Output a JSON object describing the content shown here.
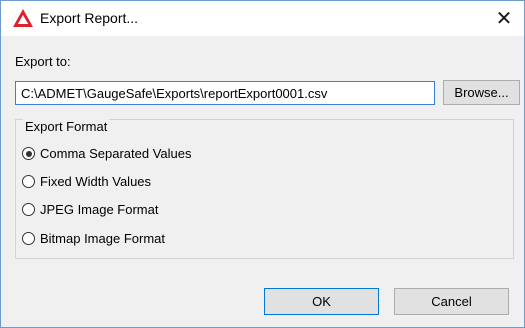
{
  "window": {
    "title": "Export Report...",
    "app_icon": "admet-warning-triangle-icon",
    "close_glyph": "✕"
  },
  "export_to": {
    "label": "Export to:",
    "path_value": "C:\\ADMET\\GaugeSafe\\Exports\\reportExport0001.csv",
    "browse_label": "Browse..."
  },
  "export_format": {
    "title": "Export Format",
    "options": [
      {
        "label": "Comma Separated Values",
        "checked": true
      },
      {
        "label": "Fixed Width Values",
        "checked": false
      },
      {
        "label": "JPEG Image Format",
        "checked": false
      },
      {
        "label": "Bitmap Image Format",
        "checked": false
      }
    ]
  },
  "buttons": {
    "ok_label": "OK",
    "cancel_label": "Cancel"
  },
  "colors": {
    "accent": "#0078d7",
    "icon_red": "#e0202e"
  }
}
